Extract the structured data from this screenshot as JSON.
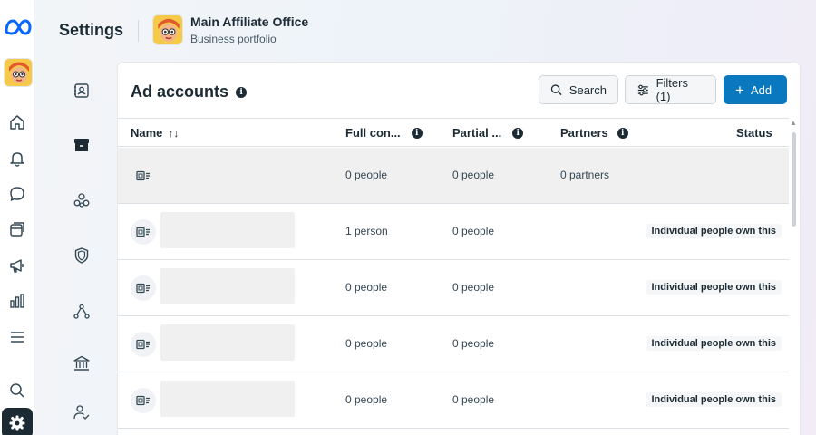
{
  "header": {
    "title": "Settings",
    "business_name": "Main Affiliate Office",
    "business_subtitle": "Business portfolio"
  },
  "rail": {
    "icons": [
      "meta-logo-icon",
      "home-icon",
      "bell-icon",
      "chat-icon",
      "pages-icon",
      "megaphone-icon",
      "bar-chart-icon",
      "menu-icon",
      "search-icon",
      "gear-icon"
    ]
  },
  "secondary_nav": {
    "icons": [
      "contact-card-icon",
      "archive-box-icon",
      "people-group-icon",
      "shield-icon",
      "network-icon",
      "bank-icon",
      "user-check-icon"
    ]
  },
  "card": {
    "title": "Ad accounts",
    "search_label": "Search",
    "filters_label": "Filters (1)",
    "add_label": "Add"
  },
  "table": {
    "columns": [
      {
        "label": "Name"
      },
      {
        "label": "Full con..."
      },
      {
        "label": "Partial ..."
      },
      {
        "label": "Partners"
      },
      {
        "label": "Status"
      }
    ],
    "rows": [
      {
        "full": "0 people",
        "partial": "0 people",
        "partners": "0 partners",
        "status": "",
        "highlight": true
      },
      {
        "full": "1 person",
        "partial": "0 people",
        "partners": "",
        "status": "Individual people own this",
        "highlight": false
      },
      {
        "full": "0 people",
        "partial": "0 people",
        "partners": "",
        "status": "Individual people own this",
        "highlight": false
      },
      {
        "full": "0 people",
        "partial": "0 people",
        "partners": "",
        "status": "Individual people own this",
        "highlight": false
      },
      {
        "full": "0 people",
        "partial": "0 people",
        "partners": "",
        "status": "Individual people own this",
        "highlight": false
      }
    ]
  },
  "colors": {
    "primary": "#0a78be",
    "text": "#1c2b33",
    "meta_blue": "#0866ff"
  }
}
